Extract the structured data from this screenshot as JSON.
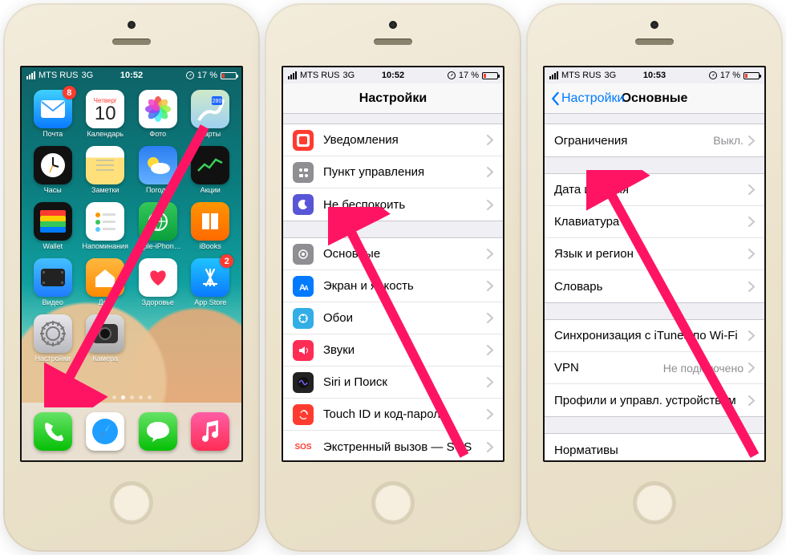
{
  "status": {
    "carrier": "MTS RUS",
    "net": "3G",
    "battery": "17 %",
    "time1": "10:52",
    "time2": "10:52",
    "time3": "10:53"
  },
  "home": {
    "calendar_day": "Четверг",
    "calendar_num": "10",
    "badge_mail": "8",
    "badge_appstore": "2",
    "apps": [
      {
        "label": "Почта",
        "bg": "linear-gradient(#3fd0ff,#0a7aff)"
      },
      {
        "label": "Календарь",
        "bg": "#ffffff"
      },
      {
        "label": "Фото",
        "bg": "#ffffff"
      },
      {
        "label": "Карты",
        "bg": "linear-gradient(#cfe9c9,#9fd1f0)"
      },
      {
        "label": "Часы",
        "bg": "#111"
      },
      {
        "label": "Заметки",
        "bg": "linear-gradient(#fff 30%,#ffe07a 30%)"
      },
      {
        "label": "Погода",
        "bg": "linear-gradient(#2b7ef2,#64b1ff)"
      },
      {
        "label": "Акции",
        "bg": "#111"
      },
      {
        "label": "Wallet",
        "bg": "#111"
      },
      {
        "label": "Напоминания",
        "bg": "#fff"
      },
      {
        "label": "Apple-iPhon…",
        "bg": "linear-gradient(#34c759,#0a9f3c)"
      },
      {
        "label": "iBooks",
        "bg": "linear-gradient(#ff9500,#ff6a00)"
      },
      {
        "label": "Видео",
        "bg": "linear-gradient(#45c0ff,#1e7cff)"
      },
      {
        "label": "Дом",
        "bg": "linear-gradient(#ffb840,#ff8a00)"
      },
      {
        "label": "Здоровье",
        "bg": "#fff"
      },
      {
        "label": "App Store",
        "bg": "linear-gradient(#20c3ff,#0a7aff)"
      },
      {
        "label": "Настройки",
        "bg": "linear-gradient(#e7e7ec,#b9b9c0)"
      },
      {
        "label": "Камера",
        "bg": "linear-gradient(#ddd,#aaa)"
      }
    ],
    "dock": [
      {
        "name": "phone",
        "bg": "linear-gradient(#66e266,#06bf06)"
      },
      {
        "name": "safari",
        "bg": "#fff"
      },
      {
        "name": "messages",
        "bg": "linear-gradient(#66e266,#06bf06)"
      },
      {
        "name": "music",
        "bg": "linear-gradient(#ff5ea5,#ff2d55)"
      }
    ]
  },
  "settings": {
    "title": "Настройки",
    "groups": [
      [
        {
          "icon": "#ff3b30",
          "label": "Уведомления"
        },
        {
          "icon": "#8e8e93",
          "label": "Пункт управления"
        },
        {
          "icon": "#5856d6",
          "label": "Не беспокоить"
        }
      ],
      [
        {
          "icon": "#8e8e93",
          "label": "Основные"
        },
        {
          "icon": "#007aff",
          "label": "Экран и яркость"
        },
        {
          "icon": "#32ade6",
          "label": "Обои"
        },
        {
          "icon": "#ff2d55",
          "label": "Звуки"
        },
        {
          "icon": "#222",
          "label": "Siri и Поиск"
        },
        {
          "icon": "#ff3b30",
          "label": "Touch ID и код-пароль"
        },
        {
          "icon": "#ff3b30",
          "label": "Экстренный вызов — SOS",
          "text": "SOS"
        }
      ]
    ]
  },
  "general": {
    "back": "Настройки",
    "title": "Основные",
    "groups": [
      [
        {
          "label": "Ограничения",
          "value": "Выкл."
        }
      ],
      [
        {
          "label": "Дата и время"
        },
        {
          "label": "Клавиатура"
        },
        {
          "label": "Язык и регион"
        },
        {
          "label": "Словарь"
        }
      ],
      [
        {
          "label": "Синхронизация с iTunes по Wi-Fi"
        },
        {
          "label": "VPN",
          "value": "Не подключено"
        },
        {
          "label": "Профили и управл. устройством"
        }
      ],
      [
        {
          "label": "Нормативы"
        }
      ]
    ]
  }
}
